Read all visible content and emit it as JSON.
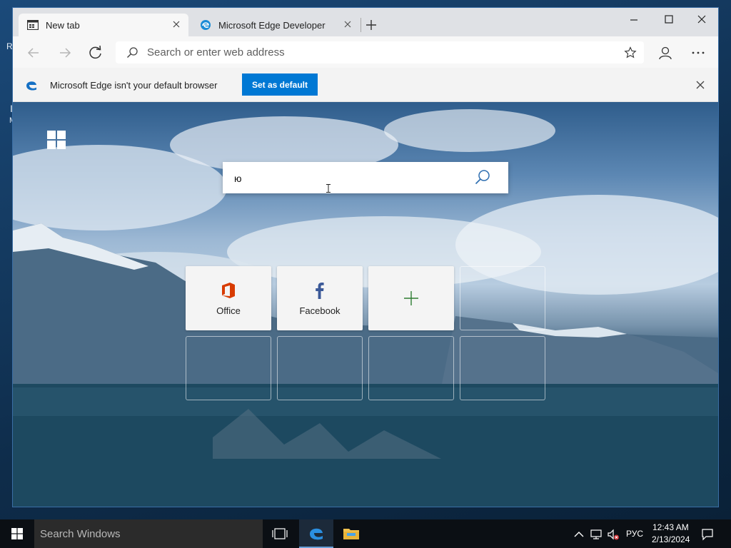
{
  "desktop": {
    "edge_char_top": "R",
    "edge_char_mid": "I",
    "edge_char_low": "M"
  },
  "browser": {
    "tabs": [
      {
        "label": "New tab",
        "icon": "new-tab-page-icon",
        "active": true
      },
      {
        "label": "Microsoft Edge Developer",
        "icon": "edge-logo-icon",
        "active": false
      }
    ],
    "address_bar": {
      "placeholder": "Search or enter web address",
      "value": ""
    },
    "infobar": {
      "message": "Microsoft Edge isn't your default browser",
      "button_label": "Set as default"
    },
    "new_tab_page": {
      "search_query": "ю",
      "tiles": [
        {
          "label": "Office",
          "icon": "office-icon",
          "type": "site"
        },
        {
          "label": "Facebook",
          "icon": "facebook-icon",
          "type": "site"
        },
        {
          "label": "",
          "icon": "plus-icon",
          "type": "add"
        },
        {
          "label": "",
          "icon": "",
          "type": "empty"
        },
        {
          "label": "",
          "icon": "",
          "type": "empty"
        },
        {
          "label": "",
          "icon": "",
          "type": "empty"
        },
        {
          "label": "",
          "icon": "",
          "type": "empty"
        },
        {
          "label": "",
          "icon": "",
          "type": "empty"
        }
      ]
    }
  },
  "taskbar": {
    "search_placeholder": "Search Windows",
    "language": "РУС",
    "time": "12:43 AM",
    "date": "2/13/2024"
  },
  "colors": {
    "accent": "#0078d4",
    "office_red": "#d83b01",
    "facebook_blue": "#3b5998",
    "taskbar": "#0b0f14"
  }
}
